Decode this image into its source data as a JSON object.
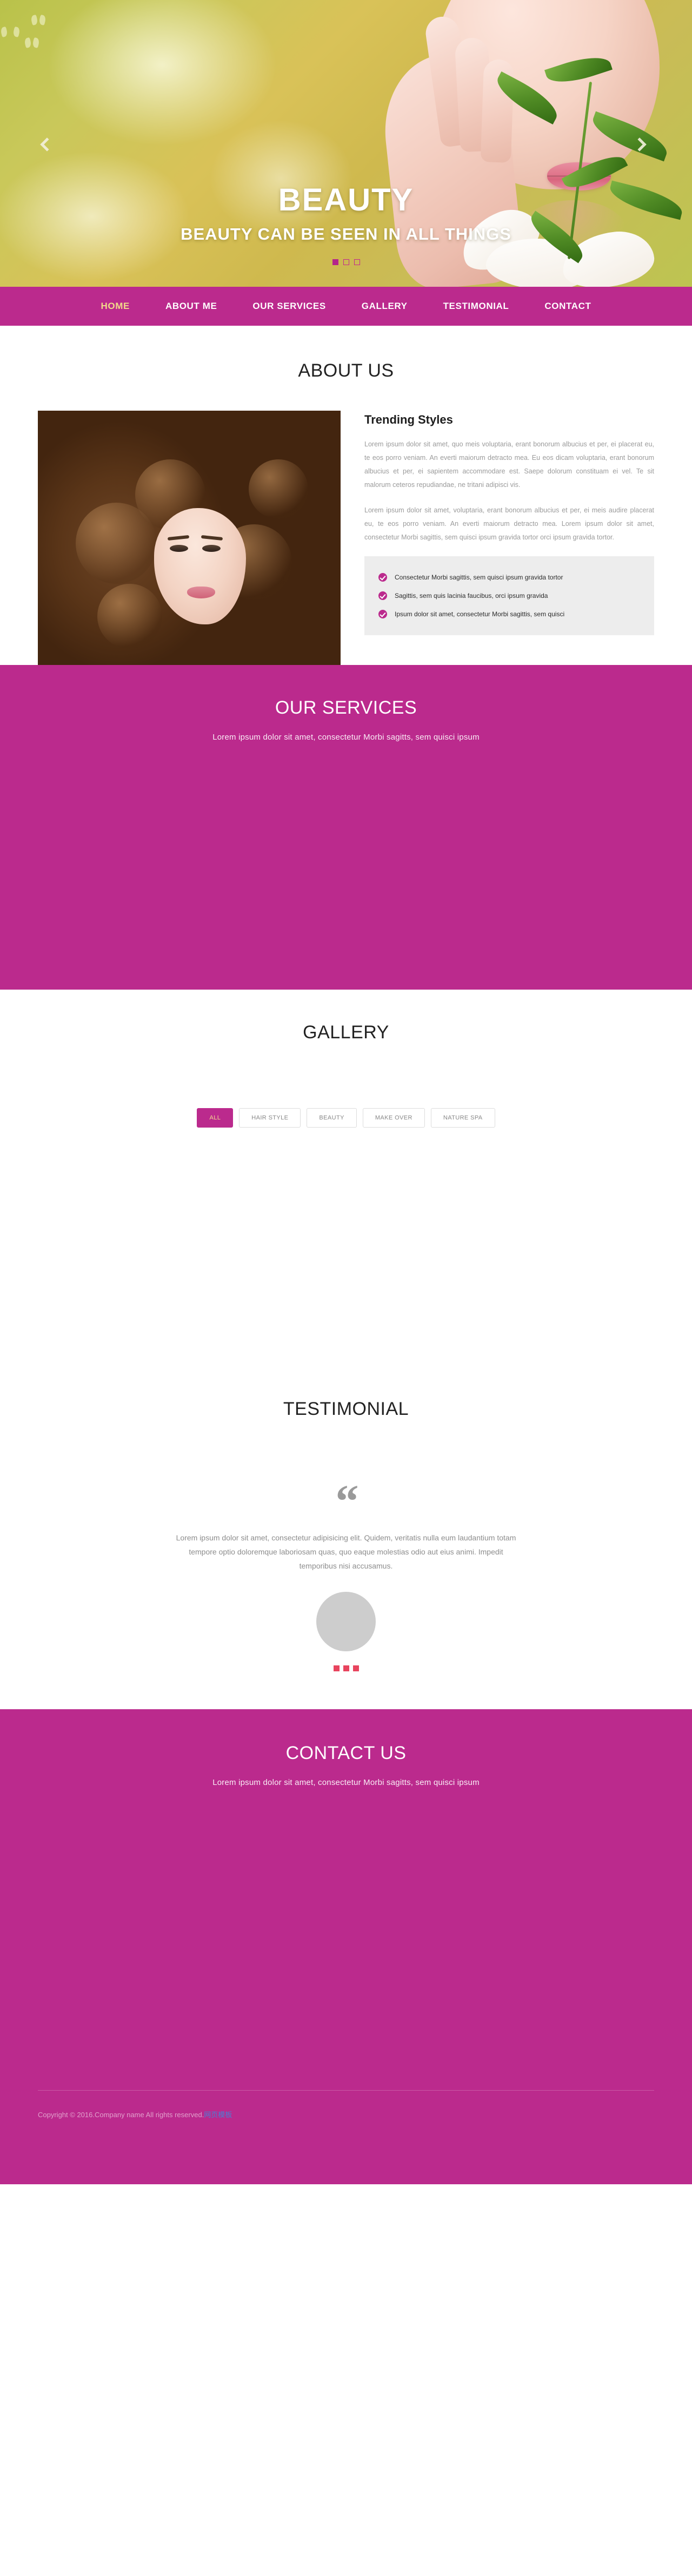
{
  "hero": {
    "title": "BEAUTY",
    "subtitle": "BEAUTY CAN BE SEEN IN ALL THINGS",
    "prev_label": "‹",
    "next_label": "›",
    "slide_count": 3,
    "active_slide": 1
  },
  "nav": {
    "items": [
      {
        "label": "HOME",
        "active": true
      },
      {
        "label": "ABOUT ME",
        "active": false
      },
      {
        "label": "OUR SERVICES",
        "active": false
      },
      {
        "label": "GALLERY",
        "active": false
      },
      {
        "label": "TESTIMONIAL",
        "active": false
      },
      {
        "label": "CONTACT",
        "active": false
      }
    ],
    "active_color": "#f2d98a",
    "bar_color": "#bb2a8d"
  },
  "about": {
    "section_title": "ABOUT US",
    "heading": "Trending Styles",
    "paragraph1": "Lorem ipsum dolor sit amet, quo meis voluptaria, erant bonorum albucius et per, ei placerat eu, te eos porro veniam. An everti maiorum detracto mea. Eu eos dicam voluptaria, erant bonorum albucius et per, ei sapientem accommodare est. Saepe dolorum constituam ei vel. Te sit malorum ceteros repudiandae, ne tritani adipisci vis.",
    "paragraph2": "Lorem ipsum dolor sit amet, voluptaria, erant bonorum albucius et per, ei meis audire placerat eu, te eos porro veniam. An everti maiorum detracto mea. Lorem ipsum dolor sit amet, consectetur Morbi sagittis, sem quisci ipsum gravida tortor orci ipsum gravida tortor.",
    "list": [
      "Consectetur Morbi sagittis, sem quisci ipsum gravida tortor",
      "Sagittis, sem quis lacinia faucibus, orci ipsum gravida",
      "Ipsum dolor sit amet, consectetur Morbi sagittis, sem quisci"
    ]
  },
  "services": {
    "section_title": "OUR SERVICES",
    "subtitle": "Lorem ipsum dolor sit amet, consectetur Morbi sagitts, sem quisci ipsum",
    "bg_color": "#bb2a8d"
  },
  "gallery": {
    "section_title": "GALLERY",
    "filters": [
      {
        "label": "ALL",
        "active": true
      },
      {
        "label": "HAIR STYLE",
        "active": false
      },
      {
        "label": "BEAUTY",
        "active": false
      },
      {
        "label": "MAKE OVER",
        "active": false
      },
      {
        "label": "NATURE SPA",
        "active": false
      }
    ]
  },
  "testimonial": {
    "section_title": "TESTIMONIAL",
    "quote_glyph": "“",
    "text": "Lorem ipsum dolor sit amet, consectetur adipisicing elit. Quidem, veritatis nulla eum laudantium totam tempore optio doloremque laboriosam quas, quo eaque molestias odio aut eius animi. Impedit temporibus nisi accusamus.",
    "dot_count": 3,
    "dot_color": "#e8445e"
  },
  "contact": {
    "section_title": "CONTACT US",
    "subtitle": "Lorem ipsum dolor sit amet, consectetur Morbi sagitts, sem quisci ipsum",
    "bg_color": "#bb2a8d"
  },
  "footer": {
    "copyright": "Copyright © 2016.Company name All rights reserved.",
    "link_label": "网页模板",
    "link_color": "#4a7fd4"
  }
}
